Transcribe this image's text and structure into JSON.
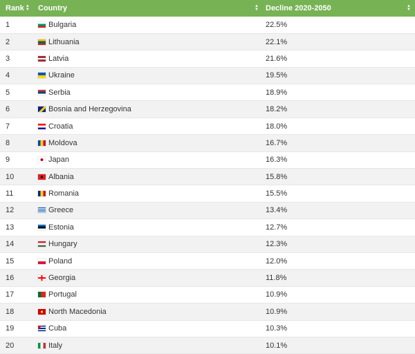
{
  "header": {
    "rank_label": "Rank",
    "country_label": "Country",
    "decline_label": "Decline 2020-2050"
  },
  "colors": {
    "header_bg": "#77b255",
    "row_alt_bg": "#f2f2f2"
  },
  "rows": [
    {
      "rank": "1",
      "country": "Bulgaria",
      "decline": "22.5%",
      "flag": "bulgaria-flag-icon"
    },
    {
      "rank": "2",
      "country": "Lithuania",
      "decline": "22.1%",
      "flag": "lithuania-flag-icon"
    },
    {
      "rank": "3",
      "country": "Latvia",
      "decline": "21.6%",
      "flag": "latvia-flag-icon"
    },
    {
      "rank": "4",
      "country": "Ukraine",
      "decline": "19.5%",
      "flag": "ukraine-flag-icon"
    },
    {
      "rank": "5",
      "country": "Serbia",
      "decline": "18.9%",
      "flag": "serbia-flag-icon"
    },
    {
      "rank": "6",
      "country": "Bosnia and Herzegovina",
      "decline": "18.2%",
      "flag": "bosnia-flag-icon"
    },
    {
      "rank": "7",
      "country": "Croatia",
      "decline": "18.0%",
      "flag": "croatia-flag-icon"
    },
    {
      "rank": "8",
      "country": "Moldova",
      "decline": "16.7%",
      "flag": "moldova-flag-icon"
    },
    {
      "rank": "9",
      "country": "Japan",
      "decline": "16.3%",
      "flag": "japan-flag-icon"
    },
    {
      "rank": "10",
      "country": "Albania",
      "decline": "15.8%",
      "flag": "albania-flag-icon"
    },
    {
      "rank": "11",
      "country": "Romania",
      "decline": "15.5%",
      "flag": "romania-flag-icon"
    },
    {
      "rank": "12",
      "country": "Greece",
      "decline": "13.4%",
      "flag": "greece-flag-icon"
    },
    {
      "rank": "13",
      "country": "Estonia",
      "decline": "12.7%",
      "flag": "estonia-flag-icon"
    },
    {
      "rank": "14",
      "country": "Hungary",
      "decline": "12.3%",
      "flag": "hungary-flag-icon"
    },
    {
      "rank": "15",
      "country": "Poland",
      "decline": "12.0%",
      "flag": "poland-flag-icon"
    },
    {
      "rank": "16",
      "country": "Georgia",
      "decline": "11.8%",
      "flag": "georgia-flag-icon"
    },
    {
      "rank": "17",
      "country": "Portugal",
      "decline": "10.9%",
      "flag": "portugal-flag-icon"
    },
    {
      "rank": "18",
      "country": "North Macedonia",
      "decline": "10.9%",
      "flag": "north-macedonia-flag-icon"
    },
    {
      "rank": "19",
      "country": "Cuba",
      "decline": "10.3%",
      "flag": "cuba-flag-icon"
    },
    {
      "rank": "20",
      "country": "Italy",
      "decline": "10.1%",
      "flag": "italy-flag-icon"
    }
  ]
}
